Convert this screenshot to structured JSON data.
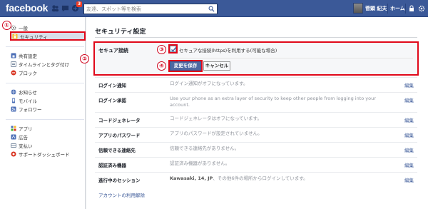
{
  "topbar": {
    "logo": "facebook",
    "notification_count": "3",
    "search_placeholder": "友達、スポット等を検索",
    "username": "菅顕 紀夫",
    "home": "ホーム"
  },
  "callouts": [
    "①",
    "②",
    "③",
    "④"
  ],
  "sidebar": {
    "items": [
      {
        "label": "一般",
        "icon": "gear-icon"
      },
      {
        "label": "セキュリティ",
        "icon": "shield-icon"
      },
      {
        "label": "共有設定",
        "icon": "lock-icon"
      },
      {
        "label": "タイムラインとタグ付け",
        "icon": "timeline-icon"
      },
      {
        "label": "ブロック",
        "icon": "block-icon"
      },
      {
        "label": "お知らせ",
        "icon": "globe-icon"
      },
      {
        "label": "モバイル",
        "icon": "mobile-icon"
      },
      {
        "label": "フォロワー",
        "icon": "rss-icon"
      },
      {
        "label": "アプリ",
        "icon": "apps-icon"
      },
      {
        "label": "広告",
        "icon": "ads-icon"
      },
      {
        "label": "支払い",
        "icon": "payment-icon"
      },
      {
        "label": "サポートダッシュボード",
        "icon": "support-icon"
      }
    ]
  },
  "main": {
    "title": "セキュリティ設定",
    "secure_browsing": {
      "label": "セキュア接続",
      "checkbox_text": "セキュアな接続(https)を利用する(可能な場合)",
      "checked": true,
      "save": "変更を保存",
      "cancel": "キャンセル"
    },
    "rows": [
      {
        "label": "ログイン通知",
        "value": "ログイン通知がオフになっています。",
        "edit": "編集"
      },
      {
        "label": "ログイン承認",
        "value": "Use your phone as an extra layer of security to keep other people from logging into your account.",
        "edit": "編集"
      },
      {
        "label": "コードジェネレータ",
        "value": "コードジェネレータはオフになっています。",
        "edit": "編集"
      },
      {
        "label": "アプリのパスワード",
        "value": "アプリのパスワードが設定されていません。",
        "edit": "編集"
      },
      {
        "label": "信頼できる連絡先",
        "value": "信頼できる連絡先がありません。",
        "edit": "編集"
      },
      {
        "label": "認証済み機器",
        "value": "認証済み機器がありません。",
        "edit": "編集"
      },
      {
        "label": "進行中のセッション",
        "value_bold": "Kawasaki, 14, JP",
        "value": "、その他6件の場所からログインしています。",
        "edit": "編集"
      }
    ],
    "deactivate": "アカウントの利用解除"
  },
  "colors": {
    "brand": "#3b5998",
    "highlight": "#e0081a"
  }
}
